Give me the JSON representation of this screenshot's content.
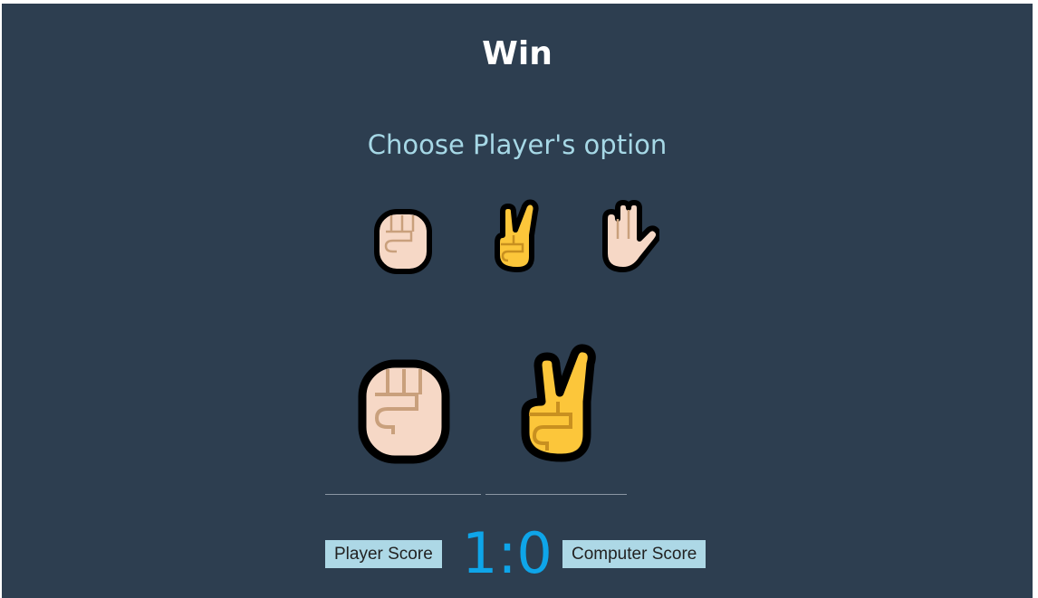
{
  "result": {
    "title": "Win"
  },
  "prompt": {
    "text": "Choose Player's option"
  },
  "options": [
    {
      "id": "rock",
      "icon": "raised-fist-icon"
    },
    {
      "id": "scissors",
      "icon": "victory-hand-icon"
    },
    {
      "id": "paper",
      "icon": "raised-hand-icon"
    }
  ],
  "round": {
    "player_choice_icon": "raised-fist-icon",
    "computer_choice_icon": "victory-hand-icon"
  },
  "score": {
    "player_label": "Player Score",
    "computer_label": "Computer Score",
    "value": "1:0"
  },
  "colors": {
    "background": "#2d3e50",
    "prompt": "#a6d8e6",
    "score_value": "#0ea5e9",
    "score_label_bg": "#add8e6",
    "skin_light": "#f6d8c6",
    "skin_yellow": "#fcc63a",
    "finger_line": "#c9a07c"
  }
}
